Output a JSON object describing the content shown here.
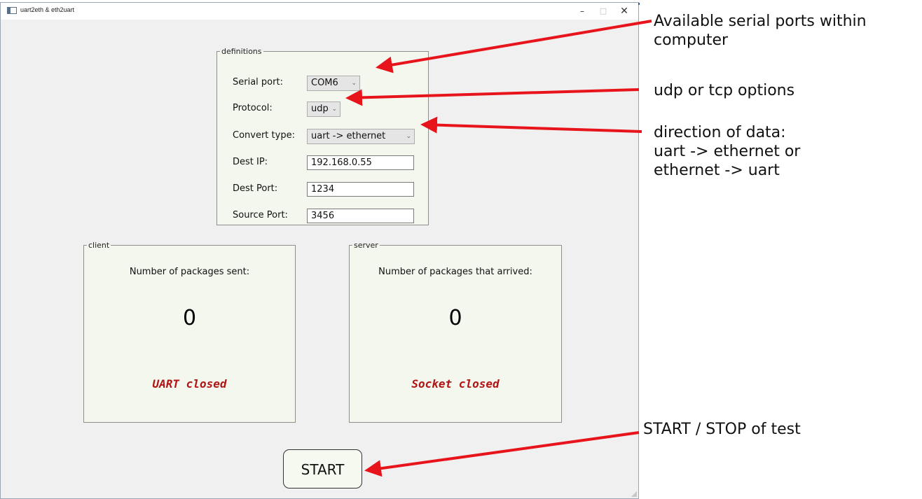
{
  "window": {
    "title": "uart2eth & eth2uart",
    "min_label": "–",
    "max_label": "□",
    "close_label": "✕"
  },
  "definitions": {
    "legend": "definitions",
    "serial_port": {
      "label": "Serial port:",
      "value": "COM6"
    },
    "protocol": {
      "label": "Protocol:",
      "value": "udp"
    },
    "convert_type": {
      "label": "Convert type:",
      "value": "uart -> ethernet"
    },
    "dest_ip": {
      "label": "Dest IP:",
      "value": "192.168.0.55"
    },
    "dest_port": {
      "label": "Dest Port:",
      "value": "1234"
    },
    "source_port": {
      "label": "Source Port:",
      "value": "3456"
    }
  },
  "client": {
    "legend": "client",
    "title": "Number of packages sent:",
    "count": "0",
    "status": "UART closed"
  },
  "server": {
    "legend": "server",
    "title": "Number of packages that arrived:",
    "count": "0",
    "status": "Socket closed"
  },
  "start_button": {
    "label": "START"
  },
  "annotations": {
    "serial_ports_line1": "Available serial ports within",
    "serial_ports_line2": "computer",
    "protocol": "udp or tcp options",
    "direction_line1": "direction of data:",
    "direction_line2": "uart -> ethernet or",
    "direction_line3": "ethernet -> uart",
    "start_stop": "START / STOP of test"
  },
  "colors": {
    "status_text": "#b01414",
    "arrow": "#e8141b",
    "panel_bg": "#f3f7ee",
    "window_bg": "#f0f0f0"
  }
}
